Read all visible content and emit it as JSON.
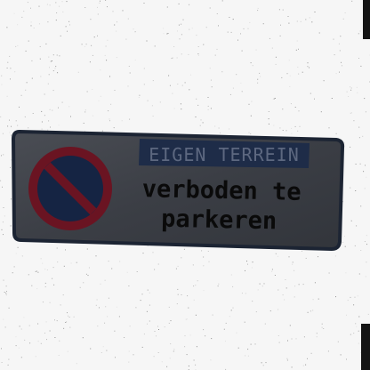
{
  "sign": {
    "banner_text": "EIGEN TERREIN",
    "line1": "verboden te",
    "line2": "parkeren",
    "icon": "no-parking-icon"
  },
  "colors": {
    "plate": "#3a3d44",
    "plate_border": "#1c2433",
    "banner_bg": "#1e2c48",
    "banner_text": "#5d6880",
    "circle_ring": "#6a1422",
    "circle_fill": "#152443",
    "main_text": "#0a0a0a"
  }
}
